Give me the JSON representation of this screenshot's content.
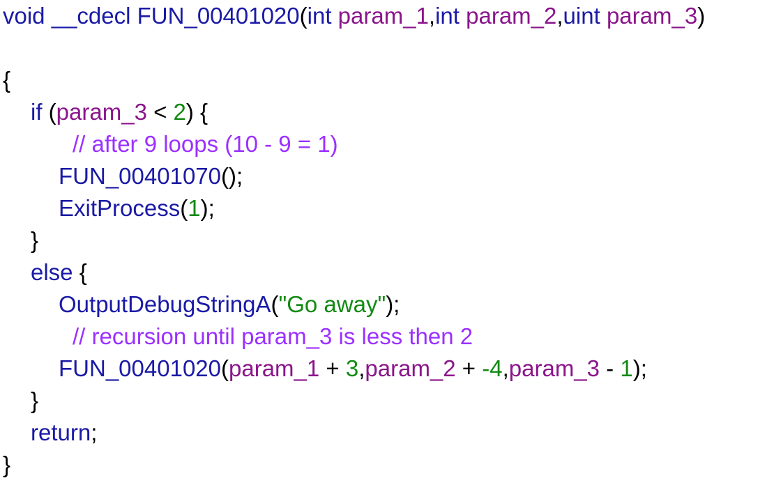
{
  "code": {
    "lines": [
      {
        "indent": 0,
        "tokens": [
          {
            "t": "kw",
            "v": "void"
          },
          {
            "t": "plain",
            "v": " "
          },
          {
            "t": "kw",
            "v": "__cdecl"
          },
          {
            "t": "plain",
            "v": " "
          },
          {
            "t": "fn",
            "v": "FUN_00401020"
          },
          {
            "t": "punc",
            "v": "("
          },
          {
            "t": "kw",
            "v": "int"
          },
          {
            "t": "plain",
            "v": " "
          },
          {
            "t": "var",
            "v": "param_1"
          },
          {
            "t": "punc",
            "v": ","
          },
          {
            "t": "kw",
            "v": "int"
          },
          {
            "t": "plain",
            "v": " "
          },
          {
            "t": "var",
            "v": "param_2"
          },
          {
            "t": "punc",
            "v": ","
          },
          {
            "t": "kw",
            "v": "uint"
          },
          {
            "t": "plain",
            "v": " "
          },
          {
            "t": "var",
            "v": "param_3"
          },
          {
            "t": "punc",
            "v": ")"
          }
        ]
      },
      {
        "indent": 0,
        "tokens": []
      },
      {
        "indent": 0,
        "tokens": [
          {
            "t": "punc",
            "v": "{"
          }
        ]
      },
      {
        "indent": 1,
        "tokens": [
          {
            "t": "kw",
            "v": "if"
          },
          {
            "t": "plain",
            "v": " "
          },
          {
            "t": "punc",
            "v": "("
          },
          {
            "t": "var",
            "v": "param_3"
          },
          {
            "t": "op",
            "v": " < "
          },
          {
            "t": "num",
            "v": "2"
          },
          {
            "t": "punc",
            "v": ") {"
          }
        ]
      },
      {
        "indent": 2.5,
        "tokens": [
          {
            "t": "cmt",
            "v": "// after 9 loops (10 - 9 = 1)"
          }
        ]
      },
      {
        "indent": 2,
        "tokens": [
          {
            "t": "fn",
            "v": "FUN_00401070"
          },
          {
            "t": "punc",
            "v": "();"
          }
        ]
      },
      {
        "indent": 2,
        "tokens": [
          {
            "t": "fn",
            "v": "ExitProcess"
          },
          {
            "t": "punc",
            "v": "("
          },
          {
            "t": "num",
            "v": "1"
          },
          {
            "t": "punc",
            "v": ");"
          }
        ]
      },
      {
        "indent": 1,
        "tokens": [
          {
            "t": "punc",
            "v": "}"
          }
        ]
      },
      {
        "indent": 1,
        "tokens": [
          {
            "t": "kw",
            "v": "else"
          },
          {
            "t": "punc",
            "v": " {"
          }
        ]
      },
      {
        "indent": 2,
        "tokens": [
          {
            "t": "fn",
            "v": "OutputDebugStringA"
          },
          {
            "t": "punc",
            "v": "("
          },
          {
            "t": "str",
            "v": "\"Go away\""
          },
          {
            "t": "punc",
            "v": ");"
          }
        ]
      },
      {
        "indent": 2.5,
        "tokens": [
          {
            "t": "cmt",
            "v": "// recursion until param_3 is less then 2"
          }
        ]
      },
      {
        "indent": 2,
        "tokens": [
          {
            "t": "fn",
            "v": "FUN_00401020"
          },
          {
            "t": "punc",
            "v": "("
          },
          {
            "t": "var",
            "v": "param_1"
          },
          {
            "t": "op",
            "v": " + "
          },
          {
            "t": "num",
            "v": "3"
          },
          {
            "t": "punc",
            "v": ","
          },
          {
            "t": "var",
            "v": "param_2"
          },
          {
            "t": "op",
            "v": " + "
          },
          {
            "t": "num",
            "v": "-4"
          },
          {
            "t": "punc",
            "v": ","
          },
          {
            "t": "var",
            "v": "param_3"
          },
          {
            "t": "op",
            "v": " - "
          },
          {
            "t": "num",
            "v": "1"
          },
          {
            "t": "punc",
            "v": ");"
          }
        ]
      },
      {
        "indent": 1,
        "tokens": [
          {
            "t": "punc",
            "v": "}"
          }
        ]
      },
      {
        "indent": 1,
        "tokens": [
          {
            "t": "kw",
            "v": "return"
          },
          {
            "t": "punc",
            "v": ";"
          }
        ]
      },
      {
        "indent": 0,
        "tokens": [
          {
            "t": "punc",
            "v": "}"
          }
        ]
      }
    ]
  }
}
